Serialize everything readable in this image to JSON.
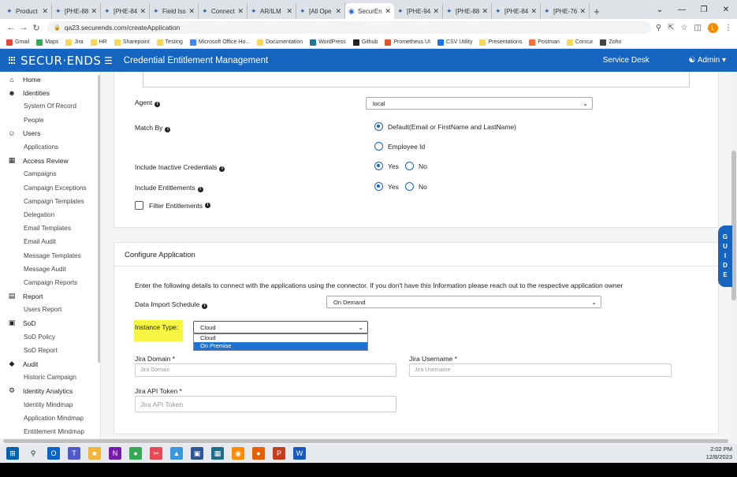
{
  "browser": {
    "tabs": [
      {
        "label": "Product",
        "active": false
      },
      {
        "label": "[PHE-88",
        "active": false
      },
      {
        "label": "[PHE-84",
        "active": false
      },
      {
        "label": "Field Iss",
        "active": false
      },
      {
        "label": "Connect",
        "active": false
      },
      {
        "label": "AR/ILM",
        "active": false
      },
      {
        "label": "[All Ope",
        "active": false
      },
      {
        "label": "SecurEn",
        "active": true
      },
      {
        "label": "[PHE-94",
        "active": false
      },
      {
        "label": "[PHE-88",
        "active": false
      },
      {
        "label": "[PHE-84",
        "active": false
      },
      {
        "label": "[PHE-76",
        "active": false
      }
    ],
    "new_tab": "+",
    "url": "qa23.securends.com/createApplication",
    "profile_initial": "L",
    "bookmarks": [
      {
        "label": "Gmail",
        "color": "#ea4335"
      },
      {
        "label": "Maps",
        "color": "#34a853"
      },
      {
        "label": "Jira",
        "color": "#f9d65c"
      },
      {
        "label": "HR",
        "color": "#f9d65c"
      },
      {
        "label": "Sharepoint",
        "color": "#f9d65c"
      },
      {
        "label": "Testing",
        "color": "#f9d65c"
      },
      {
        "label": "Microsoft Office Ho...",
        "color": "#4285f4"
      },
      {
        "label": "Documentation",
        "color": "#f9d65c"
      },
      {
        "label": "WordPress",
        "color": "#21759b"
      },
      {
        "label": "Github",
        "color": "#222222"
      },
      {
        "label": "Prometheus UI",
        "color": "#e6522c"
      },
      {
        "label": "CSV Utility",
        "color": "#1a73e8"
      },
      {
        "label": "Presentations",
        "color": "#f9d65c"
      },
      {
        "label": "Postman",
        "color": "#ff6c37"
      },
      {
        "label": "Concur",
        "color": "#f9d65c"
      },
      {
        "label": "Zoho",
        "color": "#444444"
      }
    ]
  },
  "header": {
    "logo": "SECUR·ENDS",
    "title": "Credential Entitlement Management",
    "service_desk": "Service Desk",
    "admin": "Admin"
  },
  "sidebar": {
    "items": [
      {
        "label": "Home",
        "type": "section",
        "icon": "⌂",
        "name": "home-icon"
      },
      {
        "label": "Identities",
        "type": "section",
        "icon": "☻",
        "name": "identities-icon"
      },
      {
        "label": "System Of Record",
        "type": "sub"
      },
      {
        "label": "People",
        "type": "sub"
      },
      {
        "label": "Users",
        "type": "section",
        "icon": "☺",
        "name": "users-icon"
      },
      {
        "label": "Applications",
        "type": "sub"
      },
      {
        "label": "Access Review",
        "type": "section",
        "icon": "▦",
        "name": "grid-icon"
      },
      {
        "label": "Campaigns",
        "type": "sub"
      },
      {
        "label": "Campaign Exceptions",
        "type": "sub"
      },
      {
        "label": "Campaign Templates",
        "type": "sub"
      },
      {
        "label": "Delegation",
        "type": "sub"
      },
      {
        "label": "Email Templates",
        "type": "sub"
      },
      {
        "label": "Email Audit",
        "type": "sub"
      },
      {
        "label": "Message Templates",
        "type": "sub"
      },
      {
        "label": "Message Audit",
        "type": "sub"
      },
      {
        "label": "Campaign Reports",
        "type": "sub"
      },
      {
        "label": "Report",
        "type": "section",
        "icon": "▤",
        "name": "report-icon"
      },
      {
        "label": "Users Report",
        "type": "sub"
      },
      {
        "label": "SoD",
        "type": "section",
        "icon": "▣",
        "name": "sod-icon"
      },
      {
        "label": "SoD Policy",
        "type": "sub"
      },
      {
        "label": "SoD Report",
        "type": "sub"
      },
      {
        "label": "Audit",
        "type": "section",
        "icon": "◆",
        "name": "audit-icon"
      },
      {
        "label": "Historic Campaign",
        "type": "sub"
      },
      {
        "label": "Identity Analytics",
        "type": "section",
        "icon": "⚙",
        "name": "analytics-icon"
      },
      {
        "label": "Identity Mindmap",
        "type": "sub"
      },
      {
        "label": "Application Mindmap",
        "type": "sub"
      },
      {
        "label": "Entitlement Mindmap",
        "type": "sub"
      }
    ]
  },
  "form1": {
    "agent_label": "Agent",
    "agent_value": "local",
    "match_by_label": "Match By",
    "match_default": "Default(Email or FirstName and LastName)",
    "match_employee": "Employee Id",
    "include_inactive_label": "Include Inactive Credentials",
    "include_entitlements_label": "Include Entitlements",
    "yes": "Yes",
    "no": "No",
    "filter_entitlements": "Filter Entitlements"
  },
  "configure": {
    "title": "Configure Application",
    "instructions": "Enter the following details to connect with the applications using the connector. If you don't have this Information please reach out to the respective application owner",
    "schedule_label": "Data Import Schedule",
    "schedule_value": "On Demand",
    "instance_label": "Instance Type:",
    "instance_value": "Cloud",
    "instance_options": [
      "Cloud",
      "On Premise"
    ],
    "jira_domain_label": "Jira Domain *",
    "jira_domain_placeholder": "Jira Domain",
    "jira_username_label": "Jira Username *",
    "jira_username_placeholder": "Jira Username",
    "jira_token_label": "Jira API Token *",
    "jira_token_placeholder": "Jira API Token"
  },
  "guide": [
    "G",
    "U",
    "I",
    "D",
    "E"
  ],
  "taskbar": {
    "time": "2:02 PM",
    "date": "12/8/2023",
    "icons": [
      {
        "name": "windows-start-icon",
        "color": "#0063b1",
        "glyph": "⊞"
      },
      {
        "name": "search-icon",
        "color": "#e6e9ee",
        "glyph": "⚲"
      },
      {
        "name": "outlook-icon",
        "color": "#0a64c8",
        "glyph": "O"
      },
      {
        "name": "teams-icon",
        "color": "#5059c9",
        "glyph": "T"
      },
      {
        "name": "file-explorer-icon",
        "color": "#f3b43a",
        "glyph": "■"
      },
      {
        "name": "onenote-icon",
        "color": "#7719aa",
        "glyph": "N"
      },
      {
        "name": "chrome-icon",
        "color": "#34a853",
        "glyph": "●"
      },
      {
        "name": "snipping-icon",
        "color": "#e74856",
        "glyph": "✂"
      },
      {
        "name": "paint-icon",
        "color": "#3a96dd",
        "glyph": "▲"
      },
      {
        "name": "terminal-icon",
        "color": "#2b5797",
        "glyph": "▣"
      },
      {
        "name": "remote-icon",
        "color": "#1f6f8b",
        "glyph": "▦"
      },
      {
        "name": "vpn-icon",
        "color": "#ff8c00",
        "glyph": "◉"
      },
      {
        "name": "firefox-icon",
        "color": "#e66000",
        "glyph": "●"
      },
      {
        "name": "powerpoint-icon",
        "color": "#c43e1c",
        "glyph": "P"
      },
      {
        "name": "word-icon",
        "color": "#185abd",
        "glyph": "W"
      }
    ]
  }
}
